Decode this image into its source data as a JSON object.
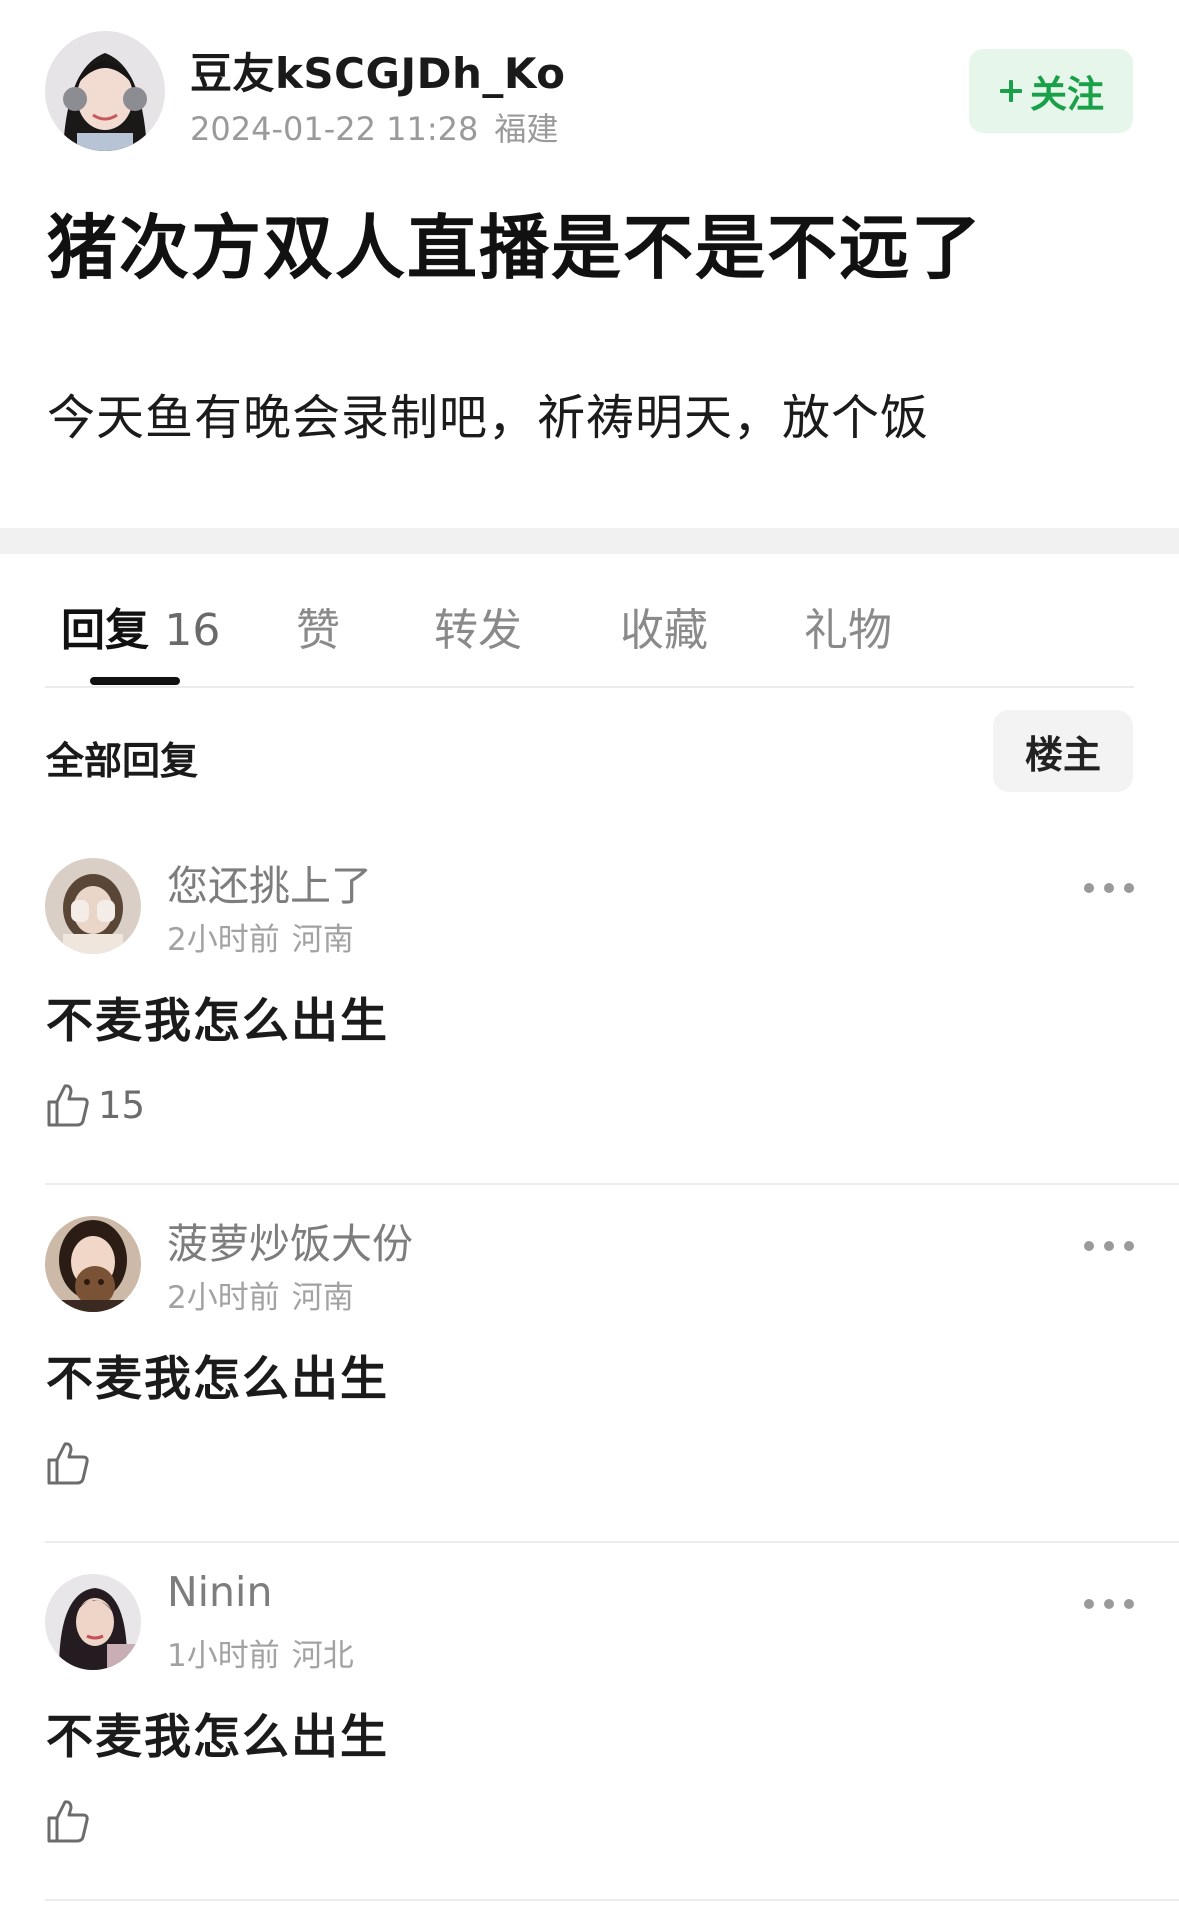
{
  "post": {
    "author": "豆友kSCGJDh_Ko",
    "date": "2024-01-22 11:28",
    "location": "福建",
    "follow_label": "关注",
    "title": "猪次方双人直播是不是不远了",
    "body": "今天鱼有晚会录制吧，祈祷明天，放个饭"
  },
  "tabs": [
    {
      "label": "回复",
      "count": "16",
      "active": true
    },
    {
      "label": "赞"
    },
    {
      "label": "转发"
    },
    {
      "label": "收藏"
    },
    {
      "label": "礼物"
    }
  ],
  "replies_header": {
    "title": "全部回复",
    "filter_label": "楼主"
  },
  "comments": [
    {
      "name": "您还挑上了",
      "time": "2小时前",
      "location": "河南",
      "text": "不麦我怎么出生",
      "likes": "15"
    },
    {
      "name": "菠萝炒饭大份",
      "time": "2小时前",
      "location": "河南",
      "text": "不麦我怎么出生",
      "likes": ""
    },
    {
      "name": "Ninin",
      "time": "1小时前",
      "location": "河北",
      "text": "不麦我怎么出生",
      "likes": ""
    }
  ],
  "colors": {
    "follow_bg": "#e7f6ea",
    "follow_text": "#1aa048",
    "section_gap": "#f1f1f1"
  },
  "icons": {
    "follow": "plus-icon",
    "more": "more-dots-icon",
    "like": "thumbs-up-icon"
  }
}
